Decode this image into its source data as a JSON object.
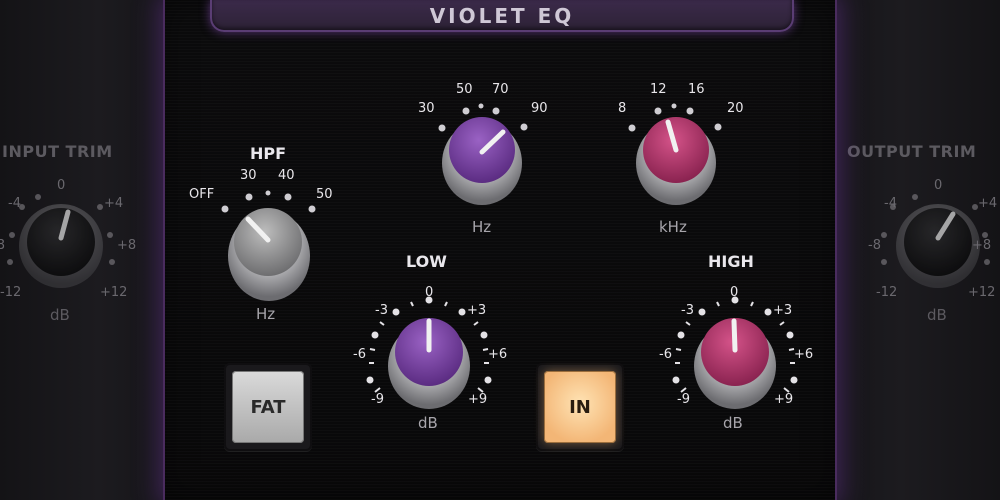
{
  "window": {
    "title": "VIOLET EQ"
  },
  "input_trim": {
    "title": "INPUT TRIM",
    "ticks": [
      "0",
      "-4",
      "+4",
      "-8",
      "+8",
      "-12",
      "+12"
    ],
    "unit": "dB"
  },
  "output_trim": {
    "title": "OUTPUT TRIM",
    "ticks": [
      "0",
      "-4",
      "+4",
      "-8",
      "+8",
      "-12",
      "+12"
    ],
    "unit": "dB"
  },
  "hpf": {
    "title": "HPF",
    "ticks": [
      "OFF",
      "30",
      "40",
      "50"
    ],
    "unit": "Hz"
  },
  "low_freq": {
    "ticks": [
      "30",
      "50",
      "70",
      "90"
    ],
    "unit": "Hz"
  },
  "high_freq": {
    "ticks": [
      "8",
      "12",
      "16",
      "20"
    ],
    "unit": "kHz"
  },
  "low_gain": {
    "title": "LOW",
    "ticks": [
      "0",
      "-3",
      "+3",
      "-6",
      "+6",
      "-9",
      "+9"
    ],
    "unit": "dB"
  },
  "high_gain": {
    "title": "HIGH",
    "ticks": [
      "0",
      "-3",
      "+3",
      "-6",
      "+6",
      "-9",
      "+9"
    ],
    "unit": "dB"
  },
  "buttons": {
    "fat": "FAT",
    "in": "IN"
  },
  "colors": {
    "accent": "#7a3fa8",
    "low_knob": "#7e44a6",
    "high_knob": "#b5346c",
    "in_button": "#f6c48a"
  },
  "icons": {
    "knob": "rotary-knob-icon"
  }
}
